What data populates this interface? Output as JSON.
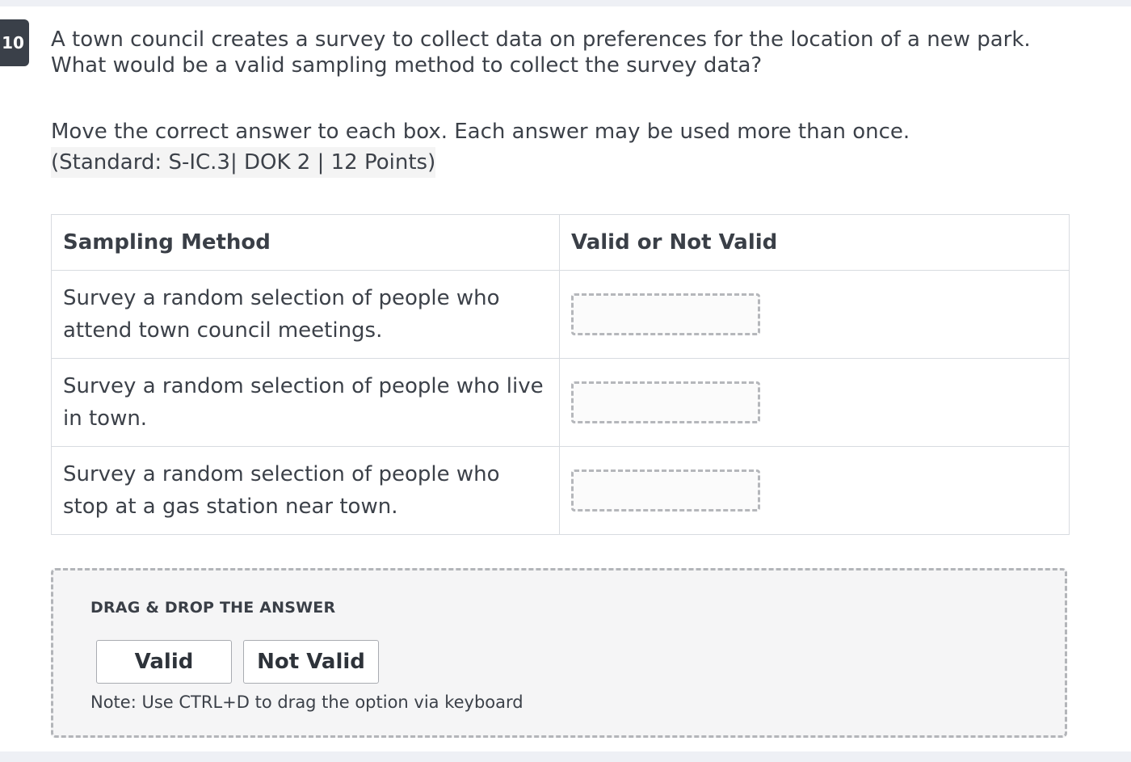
{
  "question": {
    "number": "10",
    "text": "A town council creates a survey to collect data on preferences for the location of a new park. What would be a valid sampling method to collect the survey data?"
  },
  "instructions": {
    "line1": "Move the correct answer to each box. Each answer may be used more than once.",
    "standard": "(Standard: S-IC.3| DOK 2 | 12 Points)"
  },
  "table": {
    "headers": [
      "Sampling Method",
      "Valid or Not Valid"
    ],
    "rows": [
      {
        "method": "Survey a random selection of people who attend town council meetings.",
        "answer": ""
      },
      {
        "method": "Survey a random selection of people who live in town.",
        "answer": ""
      },
      {
        "method": "Survey a random selection of people who stop at a gas station near town.",
        "answer": ""
      }
    ]
  },
  "answer_bank": {
    "title": "DRAG & DROP THE ANSWER",
    "options": [
      "Valid",
      "Not Valid"
    ],
    "note": "Note: Use CTRL+D to drag the option via keyboard"
  }
}
